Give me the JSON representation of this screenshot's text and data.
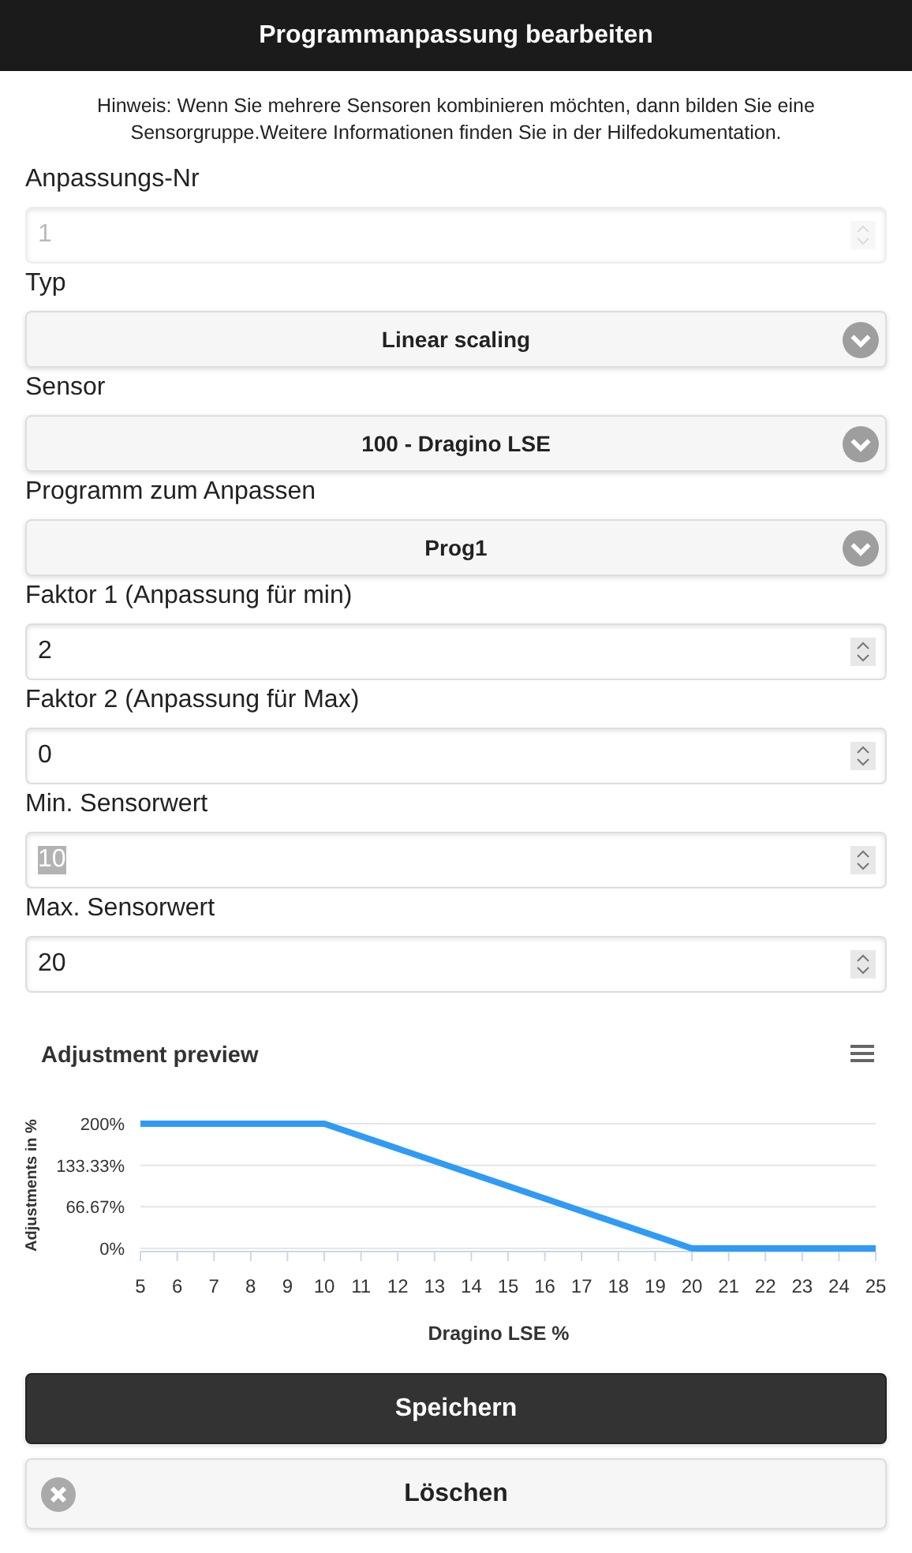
{
  "header": {
    "title": "Programmanpassung bearbeiten"
  },
  "hint": "Hinweis: Wenn Sie mehrere Sensoren kombinieren möchten, dann bilden Sie eine Sensorgruppe.Weitere Informationen finden Sie in der Hilfedokumentation.",
  "fields": [
    {
      "kind": "number",
      "label": "Anpassungs-Nr",
      "value": "1",
      "disabled": true,
      "text_selected": false
    },
    {
      "kind": "select",
      "label": "Typ",
      "value": "Linear scaling"
    },
    {
      "kind": "select",
      "label": "Sensor",
      "value": "100 - Dragino LSE"
    },
    {
      "kind": "select",
      "label": "Programm zum Anpassen",
      "value": "Prog1"
    },
    {
      "kind": "number",
      "label": "Faktor 1 (Anpassung für min)",
      "value": "2",
      "disabled": false,
      "text_selected": false
    },
    {
      "kind": "number",
      "label": "Faktor 2 (Anpassung für Max)",
      "value": "0",
      "disabled": false,
      "text_selected": false
    },
    {
      "kind": "number",
      "label": "Min. Sensorwert",
      "value": "10",
      "disabled": false,
      "text_selected": true
    },
    {
      "kind": "number",
      "label": "Max. Sensorwert",
      "value": "20",
      "disabled": false,
      "text_selected": false
    }
  ],
  "chart": {
    "chart_data": {
      "type": "line",
      "title": "Adjustment preview",
      "xlabel": "Dragino LSE %",
      "ylabel": "Adjustments in %",
      "x": [
        5,
        10,
        20,
        25
      ],
      "series": [
        {
          "color": "#2f9bf5",
          "values": [
            200,
            200,
            0,
            0
          ]
        }
      ],
      "xlim": [
        5,
        25
      ],
      "ylim": [
        0,
        200
      ],
      "xticks": [
        5,
        6,
        7,
        8,
        9,
        10,
        11,
        12,
        13,
        14,
        15,
        16,
        17,
        18,
        19,
        20,
        21,
        22,
        23,
        24,
        25
      ],
      "yticks": [
        {
          "value": 0,
          "label": "0%"
        },
        {
          "value": 66.67,
          "label": "66.67%"
        },
        {
          "value": 133.33,
          "label": "133.33%"
        },
        {
          "value": 200,
          "label": "200%"
        }
      ]
    }
  },
  "buttons": [
    {
      "kind": "primary",
      "label": "Speichern"
    },
    {
      "kind": "delete",
      "label": "Löschen"
    }
  ]
}
